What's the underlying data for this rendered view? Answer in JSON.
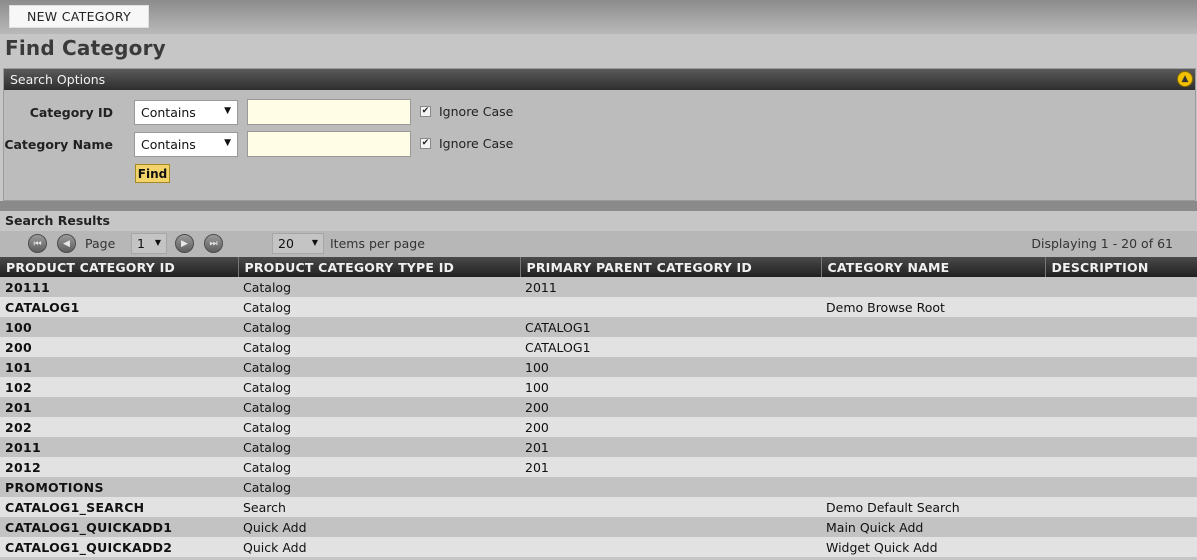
{
  "toolbar": {
    "new_category_label": "NEW CATEGORY"
  },
  "page": {
    "title": "Find Category"
  },
  "search_options": {
    "title": "Search Options",
    "collapse_icon": "chevron-up-icon",
    "category_id": {
      "label": "Category ID",
      "operator": "Contains",
      "value": "",
      "ignore_case_checked": true,
      "ignore_case_label": "Ignore Case"
    },
    "category_name": {
      "label": "Category Name",
      "operator": "Contains",
      "value": "",
      "ignore_case_checked": true,
      "ignore_case_label": "Ignore Case"
    },
    "find_label": "Find"
  },
  "results": {
    "title": "Search Results",
    "pager": {
      "page_label": "Page",
      "current_page": "1",
      "items_per_page": "20",
      "items_per_page_label": "Items per page",
      "displaying": "Displaying 1 - 20 of 61"
    },
    "columns": [
      "PRODUCT CATEGORY ID",
      "PRODUCT CATEGORY TYPE ID",
      "PRIMARY PARENT CATEGORY ID",
      "CATEGORY NAME",
      "DESCRIPTION"
    ],
    "rows": [
      [
        "20111",
        "Catalog",
        "2011",
        "",
        ""
      ],
      [
        "CATALOG1",
        "Catalog",
        "",
        "Demo Browse Root",
        ""
      ],
      [
        "100",
        "Catalog",
        "CATALOG1",
        "",
        ""
      ],
      [
        "200",
        "Catalog",
        "CATALOG1",
        "",
        ""
      ],
      [
        "101",
        "Catalog",
        "100",
        "",
        ""
      ],
      [
        "102",
        "Catalog",
        "100",
        "",
        ""
      ],
      [
        "201",
        "Catalog",
        "200",
        "",
        ""
      ],
      [
        "202",
        "Catalog",
        "200",
        "",
        ""
      ],
      [
        "2011",
        "Catalog",
        "201",
        "",
        ""
      ],
      [
        "2012",
        "Catalog",
        "201",
        "",
        ""
      ],
      [
        "PROMOTIONS",
        "Catalog",
        "",
        "",
        ""
      ],
      [
        "CATALOG1_SEARCH",
        "Search",
        "",
        "Demo Default Search",
        ""
      ],
      [
        "CATALOG1_QUICKADD1",
        "Quick Add",
        "",
        "Main Quick Add",
        ""
      ],
      [
        "CATALOG1_QUICKADD2",
        "Quick Add",
        "",
        "Widget Quick Add",
        ""
      ]
    ]
  }
}
